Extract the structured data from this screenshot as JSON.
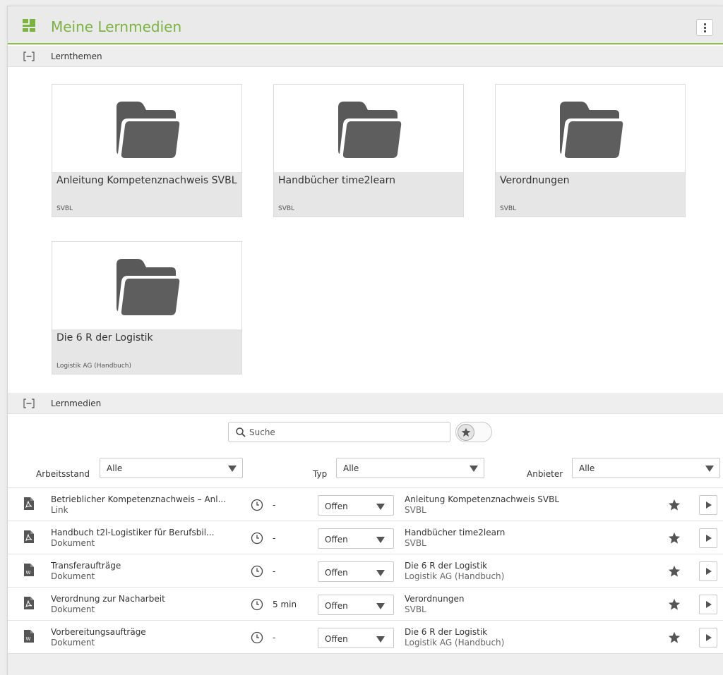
{
  "header": {
    "title": "Meine Lernmedien"
  },
  "colors": {
    "accent": "#7ab33e",
    "header_bg": "#eaeaea",
    "tile_footer": "#e6e6e6"
  },
  "sections": {
    "lernthemen": {
      "label": "Lernthemen"
    },
    "lernmedien": {
      "label": "Lernmedien"
    }
  },
  "tiles": [
    {
      "title": "Anleitung Kompetenznachweis SVBL",
      "sub": "SVBL"
    },
    {
      "title": "Handbücher time2learn",
      "sub": "SVBL"
    },
    {
      "title": "Verordnungen",
      "sub": "SVBL"
    },
    {
      "title": "Die 6 R der Logistik",
      "sub": "Logistik AG (Handbuch)"
    }
  ],
  "search": {
    "placeholder": "Suche"
  },
  "filters": {
    "arbeitsstand": {
      "label": "Arbeitsstand",
      "value": "Alle"
    },
    "typ": {
      "label": "Typ",
      "value": "Alle"
    },
    "anbieter": {
      "label": "Anbieter",
      "value": "Alle"
    }
  },
  "rows": [
    {
      "title": "Betrieblicher Kompetenznachweis – Anl...",
      "type": "Link",
      "icon": "pdf-icon",
      "duration": "-",
      "status": "Offen",
      "provider": "Anleitung Kompetenznachweis SVBL",
      "provider_sub": "SVBL"
    },
    {
      "title": "Handbuch t2l-Logistiker für Berufsbil...",
      "type": "Dokument",
      "icon": "pdf-icon",
      "duration": "-",
      "status": "Offen",
      "provider": "Handbücher time2learn",
      "provider_sub": "SVBL"
    },
    {
      "title": "Transferaufträge",
      "type": "Dokument",
      "icon": "word-icon",
      "duration": "-",
      "status": "Offen",
      "provider": "Die 6 R der Logistik",
      "provider_sub": "Logistik AG (Handbuch)"
    },
    {
      "title": "Verordnung zur Nacharbeit",
      "type": "Dokument",
      "icon": "pdf-icon",
      "duration": "5 min",
      "status": "Offen",
      "provider": "Verordnungen",
      "provider_sub": "SVBL"
    },
    {
      "title": "Vorbereitungsaufträge",
      "type": "Dokument",
      "icon": "word-icon",
      "duration": "-",
      "status": "Offen",
      "provider": "Die 6 R der Logistik",
      "provider_sub": "Logistik AG (Handbuch)"
    }
  ]
}
